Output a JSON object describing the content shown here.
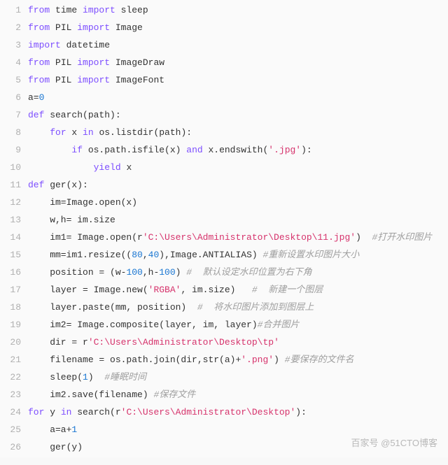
{
  "watermark": "百家号 @51CTO博客",
  "lines": [
    {
      "n": "1",
      "segs": [
        [
          "kw",
          "from"
        ],
        [
          "",
          " time "
        ],
        [
          "kw",
          "import"
        ],
        [
          "",
          " sleep"
        ]
      ]
    },
    {
      "n": "2",
      "segs": [
        [
          "kw",
          "from"
        ],
        [
          "",
          " PIL "
        ],
        [
          "kw",
          "import"
        ],
        [
          "",
          " Image"
        ]
      ]
    },
    {
      "n": "3",
      "segs": [
        [
          "kw",
          "import"
        ],
        [
          "",
          " datetime"
        ]
      ]
    },
    {
      "n": "4",
      "segs": [
        [
          "kw",
          "from"
        ],
        [
          "",
          " PIL "
        ],
        [
          "kw",
          "import"
        ],
        [
          "",
          " ImageDraw"
        ]
      ]
    },
    {
      "n": "5",
      "segs": [
        [
          "kw",
          "from"
        ],
        [
          "",
          " PIL "
        ],
        [
          "kw",
          "import"
        ],
        [
          "",
          " ImageFont"
        ]
      ]
    },
    {
      "n": "6",
      "segs": [
        [
          "",
          "a="
        ],
        [
          "num",
          "0"
        ]
      ]
    },
    {
      "n": "7",
      "segs": [
        [
          "kw",
          "def"
        ],
        [
          "",
          " search(path):"
        ]
      ]
    },
    {
      "n": "8",
      "segs": [
        [
          "",
          "    "
        ],
        [
          "kw",
          "for"
        ],
        [
          "",
          " x "
        ],
        [
          "kw",
          "in"
        ],
        [
          "",
          " os.listdir(path):"
        ]
      ]
    },
    {
      "n": "9",
      "segs": [
        [
          "",
          "        "
        ],
        [
          "kw",
          "if"
        ],
        [
          "",
          " os.path.isfile(x) "
        ],
        [
          "kw",
          "and"
        ],
        [
          "",
          " x.endswith("
        ],
        [
          "str",
          "'.jpg'"
        ],
        [
          "",
          "):"
        ]
      ]
    },
    {
      "n": "10",
      "segs": [
        [
          "",
          "            "
        ],
        [
          "kw",
          "yield"
        ],
        [
          "",
          " x"
        ]
      ]
    },
    {
      "n": "11",
      "segs": [
        [
          "kw",
          "def"
        ],
        [
          "",
          " ger(x):"
        ]
      ]
    },
    {
      "n": "12",
      "segs": [
        [
          "",
          "    im=Image.open(x)"
        ]
      ]
    },
    {
      "n": "13",
      "segs": [
        [
          "",
          "    w,h= im.size"
        ]
      ]
    },
    {
      "n": "14",
      "segs": [
        [
          "",
          "    im1= Image.open(r"
        ],
        [
          "str",
          "'C:\\Users\\Administrator\\Desktop\\11.jpg'"
        ],
        [
          "",
          ")  "
        ],
        [
          "cmt",
          "#打开水印图片"
        ]
      ]
    },
    {
      "n": "15",
      "segs": [
        [
          "",
          "    mm=im1.resize(("
        ],
        [
          "num",
          "80"
        ],
        [
          "",
          ","
        ],
        [
          "num",
          "40"
        ],
        [
          "",
          "),Image.ANTIALIAS) "
        ],
        [
          "cmt",
          "#重新设置水印图片大小"
        ]
      ]
    },
    {
      "n": "16",
      "segs": [
        [
          "",
          "    position = (w-"
        ],
        [
          "num",
          "100"
        ],
        [
          "",
          ",h-"
        ],
        [
          "num",
          "100"
        ],
        [
          "",
          ") "
        ],
        [
          "cmt",
          "#  默认设定水印位置为右下角"
        ]
      ]
    },
    {
      "n": "17",
      "segs": [
        [
          "",
          "    layer = Image.new("
        ],
        [
          "str",
          "'RGBA'"
        ],
        [
          "",
          ", im.size)   "
        ],
        [
          "cmt",
          "#  新建一个图层"
        ]
      ]
    },
    {
      "n": "18",
      "segs": [
        [
          "",
          "    layer.paste(mm, position)  "
        ],
        [
          "cmt",
          "#  将水印图片添加到图层上"
        ]
      ]
    },
    {
      "n": "19",
      "segs": [
        [
          "",
          "    im2= Image.composite(layer, im, layer)"
        ],
        [
          "cmt",
          "#合并图片"
        ]
      ]
    },
    {
      "n": "20",
      "segs": [
        [
          "",
          "    dir = r"
        ],
        [
          "str",
          "'C:\\Users\\Administrator\\Desktop\\tp'"
        ]
      ]
    },
    {
      "n": "21",
      "segs": [
        [
          "",
          "    filename = os.path.join(dir,str(a)+"
        ],
        [
          "str",
          "'.png'"
        ],
        [
          "",
          ") "
        ],
        [
          "cmt",
          "#要保存的文件名"
        ]
      ]
    },
    {
      "n": "22",
      "segs": [
        [
          "",
          "    sleep("
        ],
        [
          "num",
          "1"
        ],
        [
          "",
          ")  "
        ],
        [
          "cmt",
          "#睡眠时间"
        ]
      ]
    },
    {
      "n": "23",
      "segs": [
        [
          "",
          "    im2.save(filename) "
        ],
        [
          "cmt",
          "#保存文件"
        ]
      ]
    },
    {
      "n": "24",
      "segs": [
        [
          "kw",
          "for"
        ],
        [
          "",
          " y "
        ],
        [
          "kw",
          "in"
        ],
        [
          "",
          " search(r"
        ],
        [
          "str",
          "'C:\\Users\\Administrator\\Desktop'"
        ],
        [
          "",
          "):"
        ]
      ]
    },
    {
      "n": "25",
      "segs": [
        [
          "",
          "    a=a+"
        ],
        [
          "num",
          "1"
        ]
      ]
    },
    {
      "n": "26",
      "segs": [
        [
          "",
          "    ger(y)"
        ]
      ]
    }
  ]
}
